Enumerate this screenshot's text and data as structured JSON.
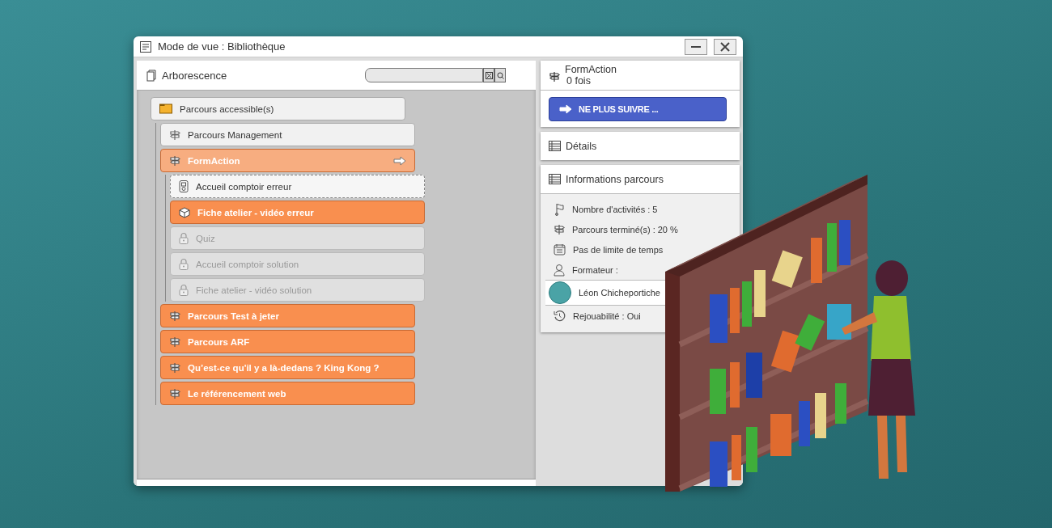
{
  "window": {
    "title": "Mode de vue : Bibliothèque"
  },
  "tree_panel": {
    "title": "Arborescence"
  },
  "tree": [
    {
      "label": "Parcours accessible(s)",
      "kind": "folder",
      "completed": false,
      "locked": false,
      "current": false,
      "selected": false,
      "children": [
        {
          "label": "Parcours Management",
          "kind": "signpost",
          "completed": false,
          "locked": false,
          "current": false,
          "selected": false
        },
        {
          "label": "FormAction",
          "kind": "signpost",
          "completed": true,
          "locked": false,
          "current": false,
          "selected": true,
          "children": [
            {
              "label": "Accueil comptoir erreur",
              "kind": "document",
              "completed": false,
              "locked": false,
              "current": true,
              "selected": false
            },
            {
              "label": "Fiche atelier - vidéo erreur",
              "kind": "cube",
              "completed": true,
              "locked": false,
              "current": false,
              "selected": false
            },
            {
              "label": "Quiz",
              "kind": "lock",
              "completed": false,
              "locked": true,
              "current": false,
              "selected": false
            },
            {
              "label": "Accueil comptoir solution",
              "kind": "lock",
              "completed": false,
              "locked": true,
              "current": false,
              "selected": false
            },
            {
              "label": "Fiche atelier - vidéo solution",
              "kind": "lock",
              "completed": false,
              "locked": true,
              "current": false,
              "selected": false
            }
          ]
        },
        {
          "label": "Parcours Test à jeter",
          "kind": "signpost",
          "completed": true,
          "locked": false,
          "current": false,
          "selected": false
        },
        {
          "label": "Parcours ARF",
          "kind": "signpost",
          "completed": true,
          "locked": false,
          "current": false,
          "selected": false
        },
        {
          "label": "Qu’est-ce qu'il y a là-dedans ? King Kong ?",
          "kind": "signpost",
          "completed": true,
          "locked": false,
          "current": false,
          "selected": false
        },
        {
          "label": "Le référencement web",
          "kind": "signpost",
          "completed": true,
          "locked": false,
          "current": false,
          "selected": false
        }
      ]
    }
  ],
  "detail": {
    "title": "FormAction",
    "count": "0 fois",
    "button": "NE PLUS SUIVRE ..."
  },
  "sections": [
    {
      "title": "Détails"
    },
    {
      "title": "Informations parcours",
      "rows": [
        {
          "kind": "flag",
          "text": "Nombre d'activités : 5"
        },
        {
          "kind": "signpost",
          "text": "Parcours terminé(s) : 20 %"
        },
        {
          "kind": "calendar",
          "text": "Pas de limite de temps"
        },
        {
          "kind": "person",
          "text": "Formateur :"
        },
        {
          "kind": "avatar",
          "text": "Léon Chicheportiche"
        },
        {
          "kind": "replay",
          "text": "Rejouabilité : Oui"
        }
      ]
    }
  ]
}
